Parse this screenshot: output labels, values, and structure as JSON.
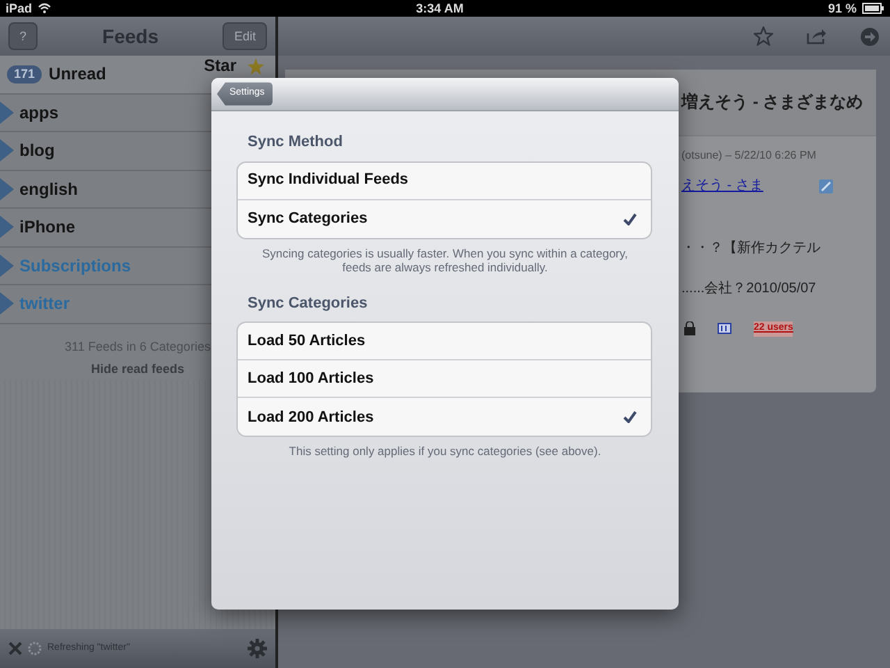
{
  "status_bar": {
    "device": "iPad",
    "time": "3:34 AM",
    "battery": "91 %"
  },
  "feeds_pane": {
    "toolbar": {
      "help_button": "?",
      "title": "Feeds",
      "edit_button": "Edit"
    },
    "unread": {
      "count": "171",
      "label": "Unread"
    },
    "starred_label": "Star",
    "categories": [
      {
        "label": "apps",
        "highlighted": false
      },
      {
        "label": "blog",
        "highlighted": false
      },
      {
        "label": "english",
        "highlighted": false
      },
      {
        "label": "iPhone",
        "highlighted": false
      },
      {
        "label": "Subscriptions",
        "highlighted": true
      },
      {
        "label": "twitter",
        "highlighted": true
      }
    ],
    "summary": "311 Feeds in 6 Categories",
    "hide_button": "Hide read feeds",
    "status": "Refreshing \"twitter\""
  },
  "article_pane": {
    "title": "増えそう - さまざまなめ",
    "meta": "(otsune) – 5/22/10 6:26 PM",
    "link": "えそう - さま",
    "lines": [
      "・・？【新作カクテル",
      "......会社？2010/05/07"
    ],
    "badge": "22 users"
  },
  "settings": {
    "back_button": "Settings",
    "sections": [
      {
        "header": "Sync Method",
        "options": [
          {
            "label": "Sync Individual Feeds",
            "selected": false
          },
          {
            "label": "Sync Categories",
            "selected": true
          }
        ],
        "footer": "Syncing categories is usually faster. When you sync within a category, feeds are always refreshed individually."
      },
      {
        "header": "Sync Categories",
        "options": [
          {
            "label": "Load 50 Articles",
            "selected": false
          },
          {
            "label": "Load 100 Articles",
            "selected": false
          },
          {
            "label": "Load 200 Articles",
            "selected": true
          }
        ],
        "footer": "This setting only applies if you sync categories (see above)."
      }
    ]
  }
}
